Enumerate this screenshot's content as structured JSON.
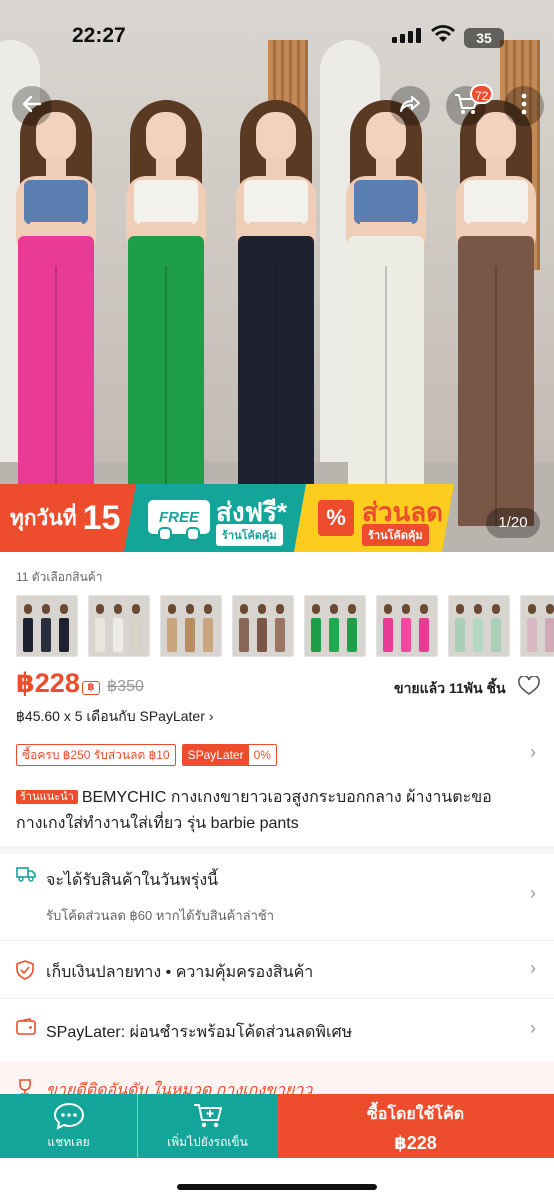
{
  "status_bar": {
    "time": "22:27",
    "battery": "35"
  },
  "cart": {
    "badge_count": "72"
  },
  "hero": {
    "image_counter": "1/20",
    "models": [
      {
        "top_color": "#5b7fb0",
        "pants_color": "#e93b95"
      },
      {
        "top_color": "#f3f1ec",
        "pants_color": "#1f9e4a"
      },
      {
        "top_color": "#f3f1ec",
        "pants_color": "#1e2230"
      },
      {
        "top_color": "#5b7fb0",
        "pants_color": "#ecebe4"
      },
      {
        "top_color": "#f3f1ec",
        "pants_color": "#7a5646"
      }
    ]
  },
  "promo": {
    "daily_prefix": "ทุกวันที่",
    "daily_day": "15",
    "free_badge": "FREE",
    "free_shipping_title": "ส่งฟรี*",
    "free_shipping_sub": "ร้านโค้ดคุ้ม",
    "discount_icon": "%",
    "discount_title": "ส่วนลด",
    "discount_sub": "ร้านโค้ดคุ้ม"
  },
  "variants": {
    "label": "11 ตัวเลือกสินค้า",
    "thumbs": [
      {
        "colors": [
          "#1e2230",
          "#2b2f3d",
          "#1e2230"
        ]
      },
      {
        "colors": [
          "#e9e5dc",
          "#ecebe4",
          "#d9d3c7"
        ]
      },
      {
        "colors": [
          "#c9a57d",
          "#b98d62",
          "#c9a57d"
        ]
      },
      {
        "colors": [
          "#8a6656",
          "#7a5646",
          "#9b7564"
        ]
      },
      {
        "colors": [
          "#1f9e4a",
          "#22a851",
          "#1f9e4a"
        ]
      },
      {
        "colors": [
          "#e93b95",
          "#f04aa0",
          "#e93b95"
        ]
      },
      {
        "colors": [
          "#a9cfb9",
          "#b5d8c3",
          "#a9cfb9"
        ]
      },
      {
        "colors": [
          "#d8b8c3",
          "#cfa9b6",
          "#d8b8c3"
        ]
      }
    ]
  },
  "price": {
    "current": "฿228",
    "coin_icon": "฿",
    "original": "฿350",
    "sold": "ขายแล้ว 11พัน ชิ้น",
    "installment": "฿45.60 x 5 เดือนกับ SPayLater"
  },
  "vouchers": {
    "v1": "ซื้อครบ ฿250 รับส่วนลด ฿10",
    "v2_label": "SPayLater",
    "v2_value": "0%"
  },
  "product": {
    "tag": "ร้านแนะนำ",
    "title": "BEMYCHIC กางเกงขายาวเอวสูงกระบอกกลาง ผ้างานตะขอ กางเกงใส่ทำงานใส่เที่ยว รุ่น barbie pants"
  },
  "sections": {
    "delivery_title": "จะได้รับสินค้าในวันพรุ่งนี้",
    "delivery_sub": "รับโค้ดส่วนลด ฿60 หากได้รับสินค้าล่าช้า",
    "cod": "เก็บเงินปลายทาง  •  ความคุ้มครองสินค้า",
    "spaylater": "SPayLater: ผ่อนชำระพร้อมโค้ดส่วนลดพิเศษ",
    "best_seller": "ขายดีติดอันดับ ในหมวด กางเกงขายาว"
  },
  "bottom_bar": {
    "chat_label": "แชทเลย",
    "add_cart_label": "เพิ่มไปยังรถเข็น",
    "buy_label": "ซื้อโดยใช้โค้ด",
    "buy_price": "฿228"
  },
  "colors": {
    "accent": "#ee4d2d",
    "teal": "#14a59a"
  }
}
